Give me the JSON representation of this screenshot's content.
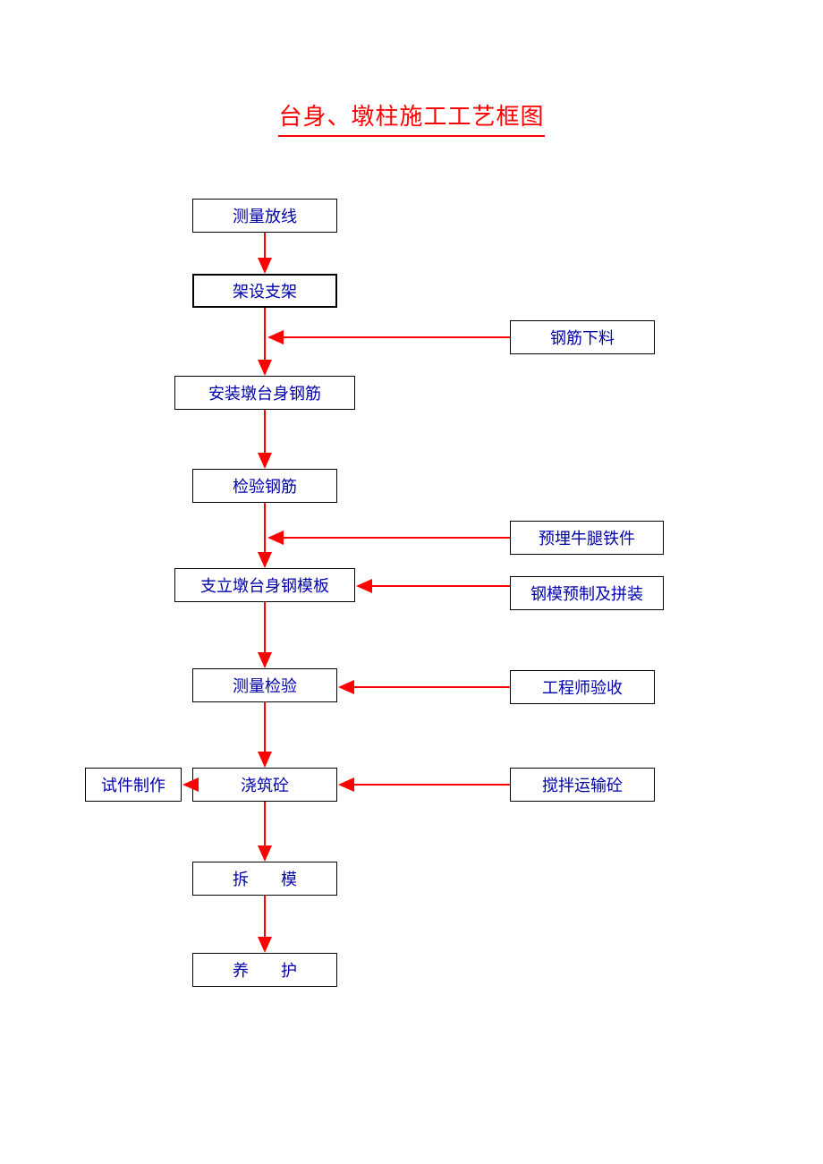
{
  "title": "台身、墩柱施工工艺框图",
  "boxes": {
    "n1": "测量放线",
    "n2": "架设支架",
    "n3": "安装墩台身钢筋",
    "n4": "检验钢筋",
    "n5": "支立墩台身钢模板",
    "n6": "测量检验",
    "n7": "浇筑砼",
    "n8": "拆　　模",
    "n9": "养　　护",
    "s1": "钢筋下料",
    "s2": "预埋牛腿铁件",
    "s3": "钢模预制及拼装",
    "s4": "工程师验收",
    "s5": "搅拌运输砼",
    "l1": "试件制作"
  }
}
